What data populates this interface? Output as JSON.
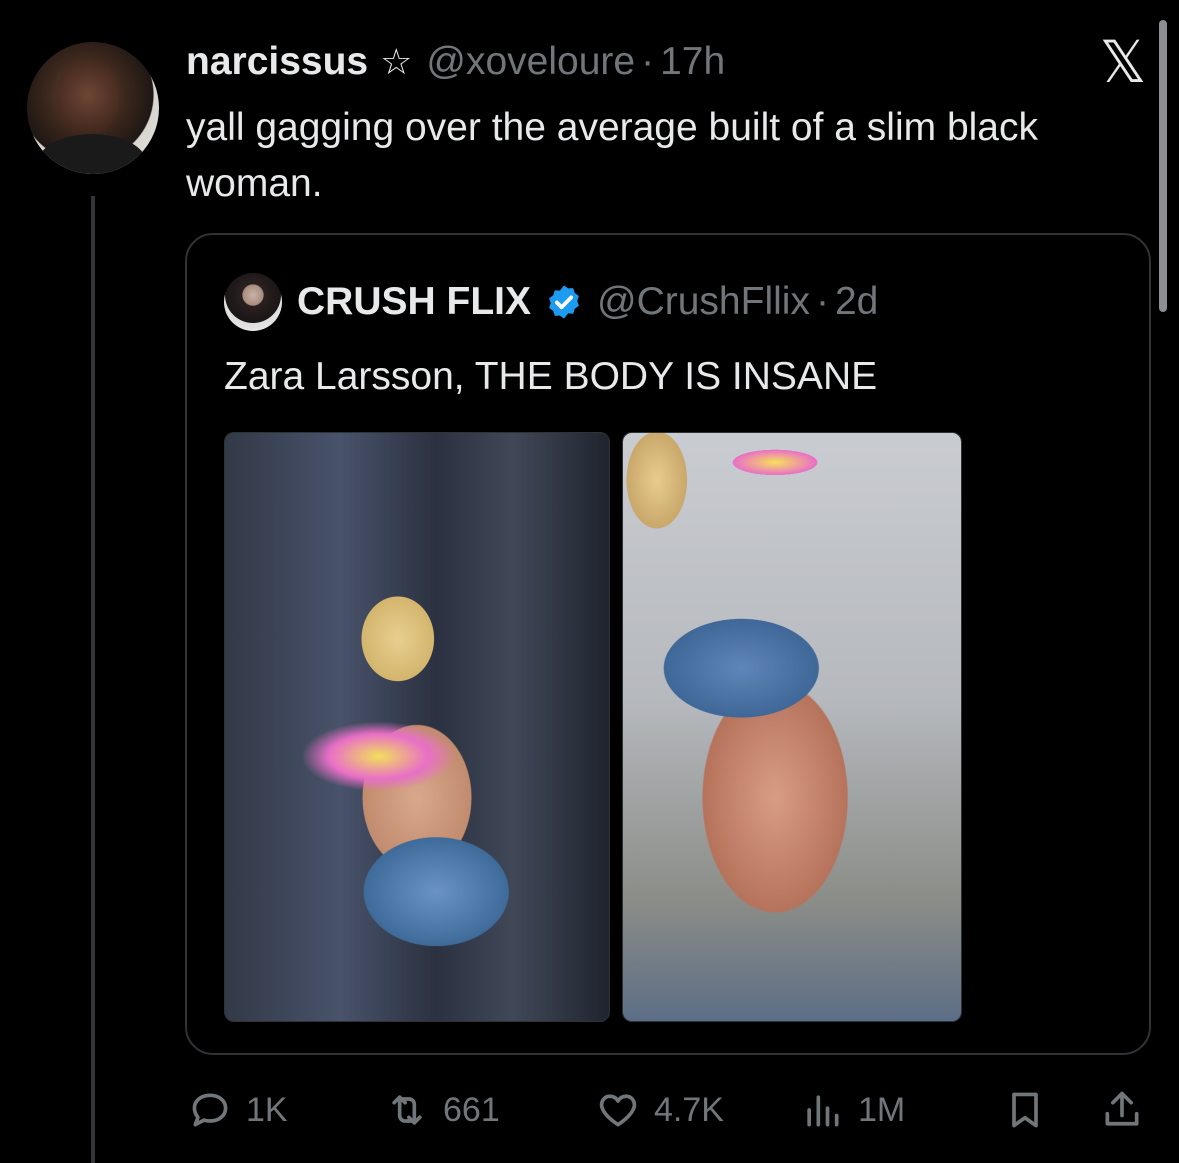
{
  "tweet": {
    "author_name": "narcissus",
    "star_glyph": "☆",
    "handle": "@xoveloure",
    "separator": "·",
    "time": "17h",
    "text": "yall gagging over the average built of a slim black woman."
  },
  "quoted_tweet": {
    "author_name": "CRUSH FLIX",
    "handle": "@CrushFllix",
    "separator": "·",
    "time": "2d",
    "text": "Zara Larsson, THE BODY IS INSANE",
    "media_count": 2
  },
  "actions": {
    "replies": "1K",
    "reposts": "661",
    "likes": "4.7K",
    "views": "1M"
  },
  "icons": {
    "x_logo": "𝕏",
    "verified_color": "#1d9bf0",
    "muted_color": "#71767b"
  }
}
